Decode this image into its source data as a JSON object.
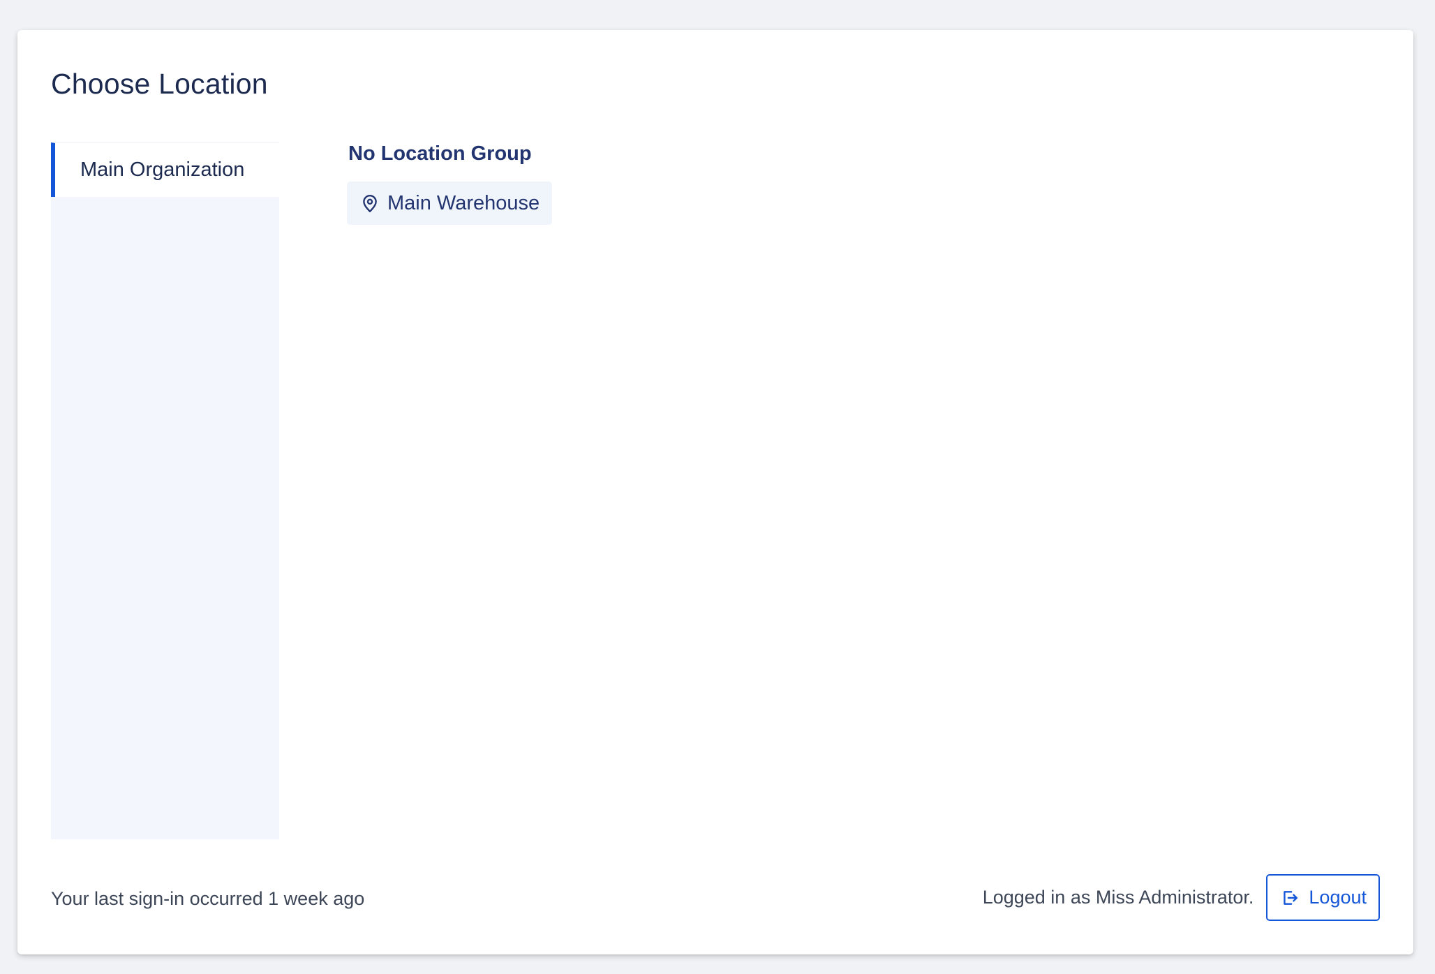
{
  "page": {
    "title": "Choose Location"
  },
  "sidebar": {
    "items": [
      {
        "label": "Main Organization",
        "selected": true
      }
    ]
  },
  "main": {
    "groups": [
      {
        "title": "No Location Group",
        "locations": [
          {
            "label": "Main Warehouse",
            "icon": "map-pin-icon"
          }
        ]
      }
    ]
  },
  "footer": {
    "last_signin": "Your last sign-in occurred 1 week ago",
    "logged_in": "Logged in as Miss Administrator.",
    "logout_label": "Logout",
    "logout_icon": "logout-icon"
  },
  "colors": {
    "accent": "#1456d8",
    "page_background": "#f0f2f5",
    "sidebar_background": "#f3f6fc",
    "location_button_background": "#f0f4fb",
    "text_primary": "#1c2a4f"
  }
}
